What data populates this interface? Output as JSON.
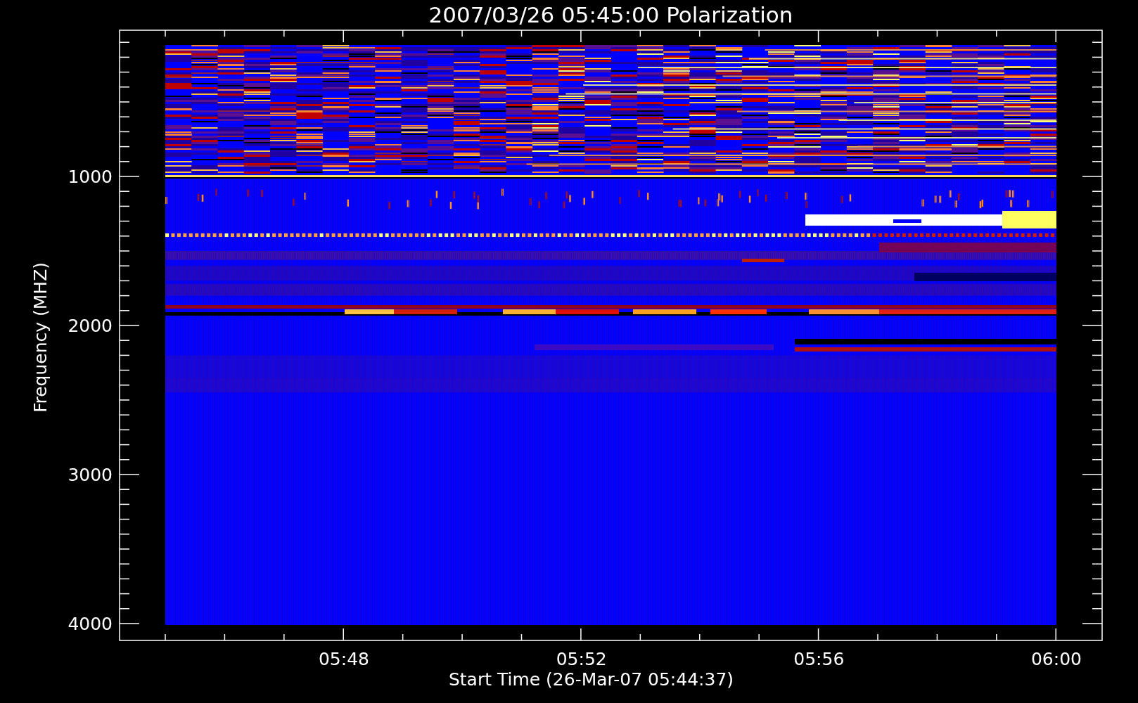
{
  "plot": {
    "title": "2007/03/26 05:45:00 Polarization",
    "xlabel": "Start Time (26-Mar-07 05:44:37)",
    "ylabel": "Frequency (MHZ)",
    "y_tick_labels": [
      "1000",
      "2000",
      "3000",
      "4000"
    ],
    "x_tick_labels": [
      "05:48",
      "05:52",
      "05:56",
      "06:00"
    ]
  }
}
